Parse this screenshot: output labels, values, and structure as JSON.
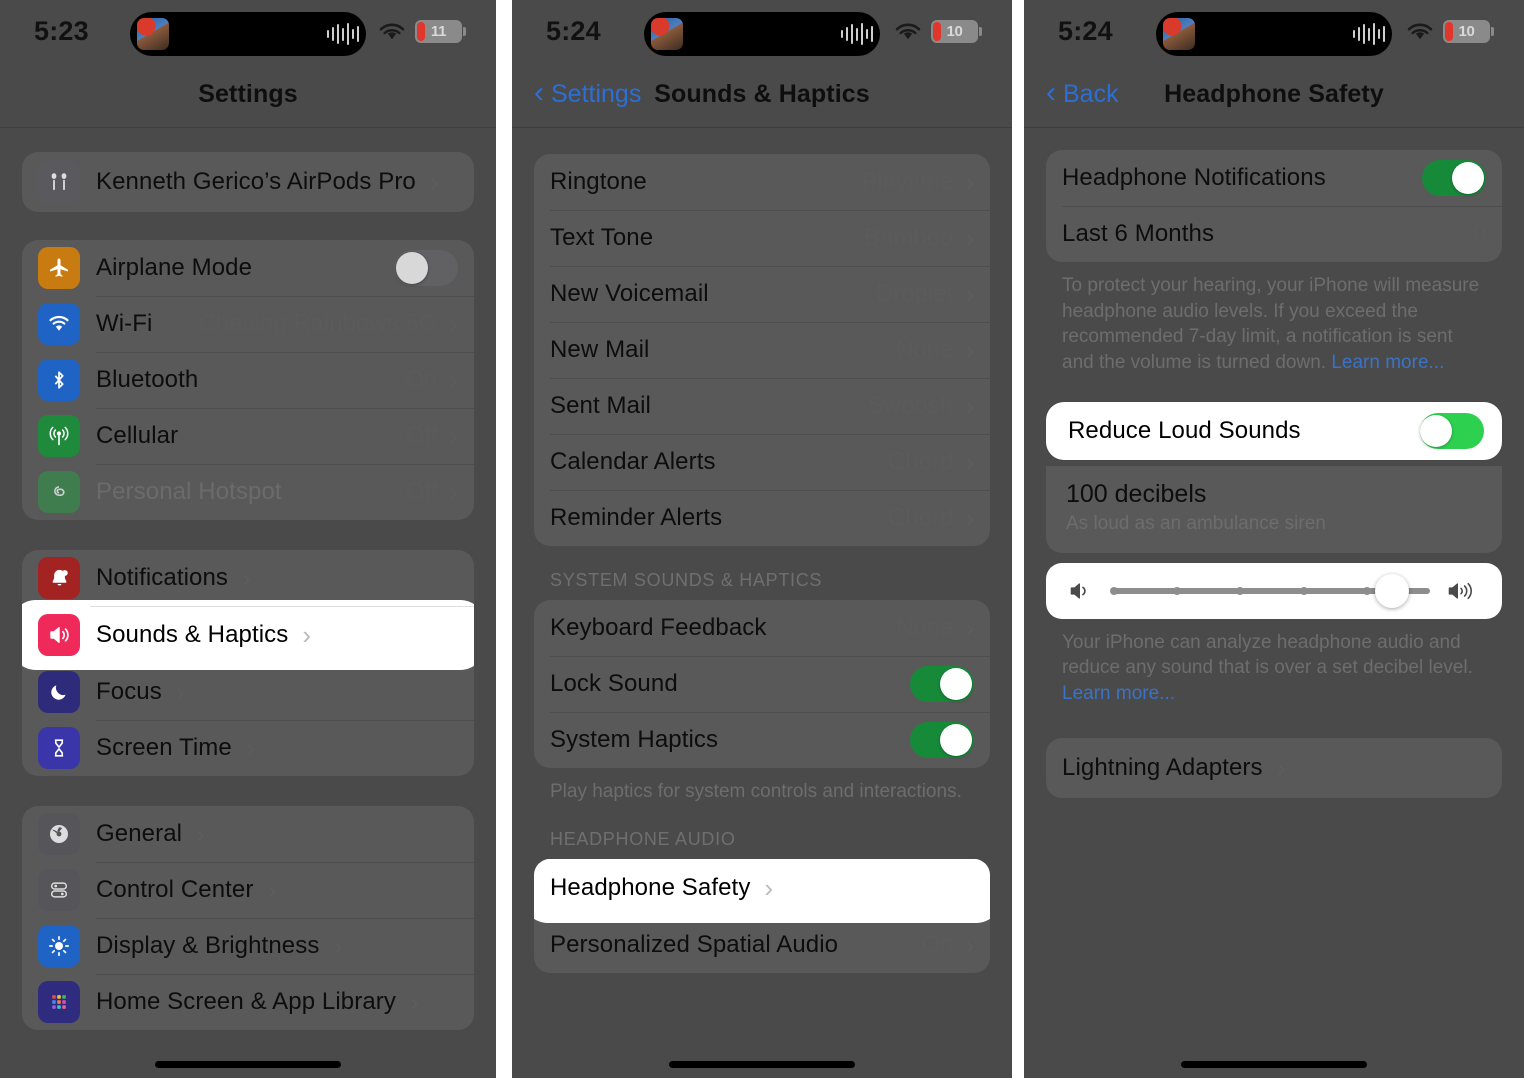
{
  "panels": [
    {
      "id": "settings",
      "status": {
        "time": "5:23",
        "battery": "11",
        "wifi_icon": "wifi-icon",
        "island_icon": "now-playing-waveform"
      },
      "nav": {
        "title": "Settings",
        "back_label": null
      },
      "groups": [
        {
          "rows": [
            {
              "label": "Kenneth Gerico’s AirPods Pro",
              "icon": "airpods-pro-icon",
              "icon_color": "#5a5a5e",
              "value": "",
              "accessory": "chevron"
            }
          ]
        },
        {
          "rows": [
            {
              "label": "Airplane Mode",
              "icon": "airplane-icon",
              "icon_color": "#c87b11",
              "accessory": "toggle-off"
            },
            {
              "label": "Wi-Fi",
              "icon": "wifi-icon",
              "icon_color": "#1f63c4",
              "value": "Chasing Rainbows 5G",
              "accessory": "chevron"
            },
            {
              "label": "Bluetooth",
              "icon": "bluetooth-icon",
              "icon_color": "#1f63c4",
              "value": "On",
              "accessory": "chevron"
            },
            {
              "label": "Cellular",
              "icon": "cellular-icon",
              "icon_color": "#1f8a3c",
              "value": "Off",
              "accessory": "chevron"
            },
            {
              "label": "Personal Hotspot",
              "icon": "hotspot-icon",
              "icon_color": "#3f7c4e",
              "value": "Off",
              "accessory": "chevron",
              "dim": true
            }
          ]
        },
        {
          "rows": [
            {
              "label": "Notifications",
              "icon": "bell-icon",
              "icon_color": "#a32222",
              "accessory": "chevron"
            },
            {
              "label": "Sounds & Haptics",
              "icon": "speaker-wave-icon",
              "icon_color": "#f0295b",
              "accessory": "chevron",
              "highlight": true
            },
            {
              "label": "Focus",
              "icon": "moon-icon",
              "icon_color": "#2e2c7a",
              "accessory": "chevron"
            },
            {
              "label": "Screen Time",
              "icon": "hourglass-icon",
              "icon_color": "#3a35a8",
              "accessory": "chevron"
            }
          ]
        },
        {
          "rows": [
            {
              "label": "General",
              "icon": "gear-icon",
              "icon_color": "#55555a",
              "accessory": "chevron"
            },
            {
              "label": "Control Center",
              "icon": "control-center-icon",
              "icon_color": "#55555a",
              "accessory": "chevron"
            },
            {
              "label": "Display & Brightness",
              "icon": "brightness-icon",
              "icon_color": "#1f63c4",
              "accessory": "chevron"
            },
            {
              "label": "Home Screen & App Library",
              "icon": "app-grid-icon",
              "icon_color": "#3a35a8",
              "accessory": "chevron"
            }
          ]
        }
      ]
    },
    {
      "id": "sounds-haptics",
      "status": {
        "time": "5:24",
        "battery": "10",
        "wifi_icon": "wifi-icon",
        "island_icon": "now-playing-waveform"
      },
      "nav": {
        "title": "Sounds & Haptics",
        "back_label": "Settings"
      },
      "groups": [
        {
          "rows": [
            {
              "label": "Ringtone",
              "value": "Playtime",
              "accessory": "chevron"
            },
            {
              "label": "Text Tone",
              "value": "Bamboo",
              "accessory": "chevron"
            },
            {
              "label": "New Voicemail",
              "value": "Droplet",
              "accessory": "chevron"
            },
            {
              "label": "New Mail",
              "value": "None",
              "accessory": "chevron"
            },
            {
              "label": "Sent Mail",
              "value": "Swoosh",
              "accessory": "chevron"
            },
            {
              "label": "Calendar Alerts",
              "value": "Chord",
              "accessory": "chevron"
            },
            {
              "label": "Reminder Alerts",
              "value": "Chord",
              "accessory": "chevron"
            }
          ]
        }
      ],
      "section2": {
        "header": "SYSTEM SOUNDS & HAPTICS",
        "rows": [
          {
            "label": "Keyboard Feedback",
            "value": "None",
            "accessory": "chevron"
          },
          {
            "label": "Lock Sound",
            "accessory": "toggle-on"
          },
          {
            "label": "System Haptics",
            "accessory": "toggle-on"
          }
        ],
        "footnote": "Play haptics for system controls and interactions."
      },
      "section3": {
        "header": "HEADPHONE AUDIO",
        "rows": [
          {
            "label": "Headphone Safety",
            "accessory": "chevron",
            "highlight": true
          },
          {
            "label": "Personalized Spatial Audio",
            "value": "On",
            "accessory": "chevron"
          }
        ]
      }
    },
    {
      "id": "headphone-safety",
      "status": {
        "time": "5:24",
        "battery": "10",
        "wifi_icon": "wifi-icon",
        "island_icon": "now-playing-waveform"
      },
      "nav": {
        "title": "Headphone Safety",
        "back_label": "Back"
      },
      "group1": {
        "rows": [
          {
            "label": "Headphone Notifications",
            "accessory": "toggle-on"
          },
          {
            "label": "Last 6 Months",
            "value": "0"
          }
        ],
        "footnote": "To protect your hearing, your iPhone will measure headphone audio levels. If you exceed the recommended 7-day limit, a notification is sent and the volume is turned down.",
        "footnote_link": "Learn more..."
      },
      "reduce": {
        "label": "Reduce Loud Sounds",
        "accessory": "toggle-on",
        "decibels": "100 decibels",
        "decibels_sub": "As loud as an ambulance siren",
        "slider": {
          "value_percent": 88,
          "ticks": [
            0,
            20,
            40,
            60,
            80
          ],
          "min_icon": "speaker-low-icon",
          "max_icon": "speaker-high-icon"
        },
        "footnote": "Your iPhone can analyze headphone audio and reduce any sound that is over a set decibel level.",
        "footnote_link": "Learn more..."
      },
      "group3": {
        "rows": [
          {
            "label": "Lightning Adapters",
            "accessory": "chevron"
          }
        ]
      }
    }
  ],
  "colors": {
    "toggle_on": "#178a3a",
    "toggle_on_bright": "#2ed04f",
    "link": "#3a73c6",
    "nav_tint": "#2b6fd6",
    "battery_low": "#e0362b"
  }
}
